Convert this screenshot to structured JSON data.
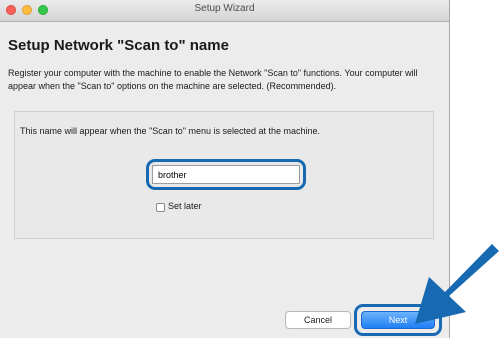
{
  "window": {
    "title": "Setup Wizard"
  },
  "page": {
    "heading": "Setup Network \"Scan to\" name",
    "description": "Register your computer with the machine to enable the Network \"Scan to\" functions. Your computer will appear when the \"Scan to\" options on the machine are selected. (Recommended)."
  },
  "panel": {
    "message": "This name will appear when the \"Scan to\" menu is selected at the machine.",
    "name_value": "brother",
    "set_later_label": "Set later",
    "set_later_checked": false
  },
  "buttons": {
    "cancel": "Cancel",
    "next": "Next"
  },
  "colors": {
    "highlight": "#1769b2",
    "primary_button": "#1f7ff5"
  },
  "icons": [
    "close-traffic-light",
    "minimize-traffic-light",
    "maximize-traffic-light",
    "pointer-arrow-icon"
  ]
}
